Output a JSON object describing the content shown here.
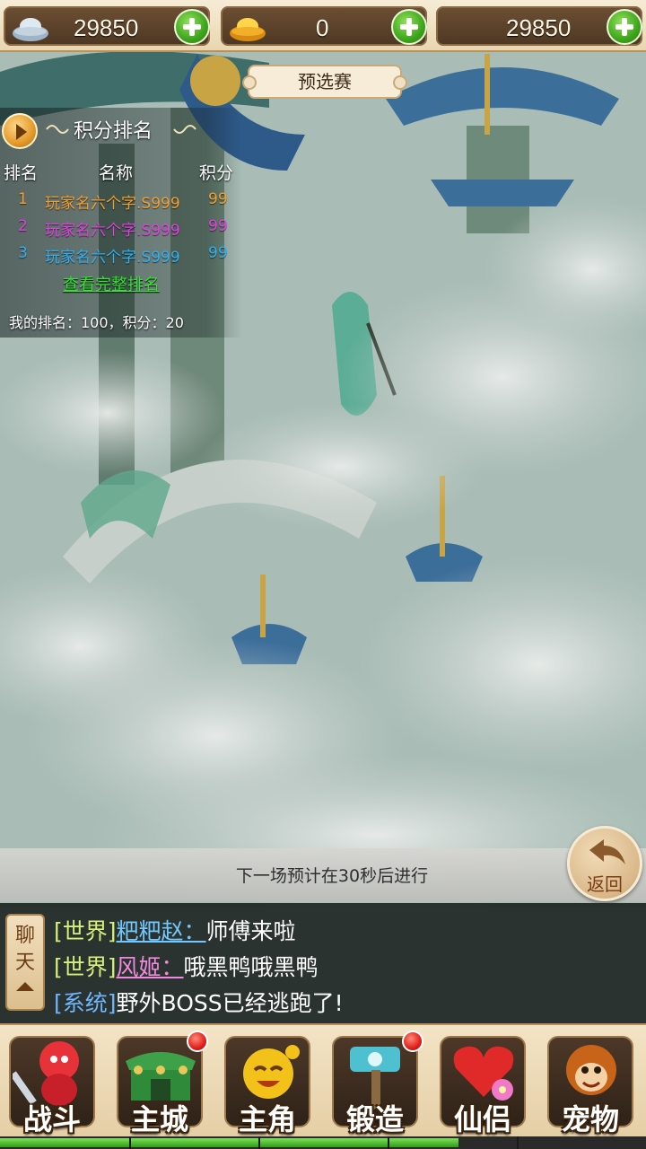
{
  "currency": [
    {
      "icon": "silver-ingot-icon",
      "value": "29850"
    },
    {
      "icon": "gold-ingot-icon",
      "value": "0"
    },
    {
      "icon": "none",
      "value": "29850"
    }
  ],
  "stage": {
    "label": "预选赛"
  },
  "ranking": {
    "title": "积分排名",
    "columns": {
      "rank": "排名",
      "name": "名称",
      "score": "积分"
    },
    "rows": [
      {
        "rank": "1",
        "name": "玩家名六个字.S999",
        "score": "99",
        "color": "#f0a030"
      },
      {
        "rank": "2",
        "name": "玩家名六个字.S999",
        "score": "99",
        "color": "#e040e0"
      },
      {
        "rank": "3",
        "name": "玩家名六个字.S999",
        "score": "99",
        "color": "#30b0f0"
      }
    ],
    "view_full": "查看完整排名",
    "my_rank": "我的排名：100，积分：20"
  },
  "next_match": {
    "text": "下一场预计在30秒后进行"
  },
  "back": {
    "label": "返回"
  },
  "chat": {
    "tab": [
      "聊",
      "天"
    ],
    "lines": [
      {
        "channel": "[世界]",
        "name": "粑粑赵：",
        "message": "师傅来啦"
      },
      {
        "channel": "[世界]",
        "name": "风姬：",
        "message": "哦黑鸭哦黑鸭"
      },
      {
        "channel": "[系统]",
        "message": "野外BOSS已经逃跑了!"
      }
    ]
  },
  "nav": [
    {
      "label": "战斗",
      "icon": "sword-warrior-icon",
      "badge": false
    },
    {
      "label": "主城",
      "icon": "city-gate-icon",
      "badge": true
    },
    {
      "label": "主角",
      "icon": "hero-face-icon",
      "badge": false
    },
    {
      "label": "锻造",
      "icon": "hammer-icon",
      "badge": true
    },
    {
      "label": "仙侣",
      "icon": "heart-flower-icon",
      "badge": false
    },
    {
      "label": "宠物",
      "icon": "monkey-icon",
      "badge": false
    }
  ],
  "progress": {
    "fill_fraction": 0.71
  },
  "colors": {
    "accent_green": "#3fa51c",
    "panel_brown": "#4f3823",
    "parchment": "#f3e4c6"
  }
}
